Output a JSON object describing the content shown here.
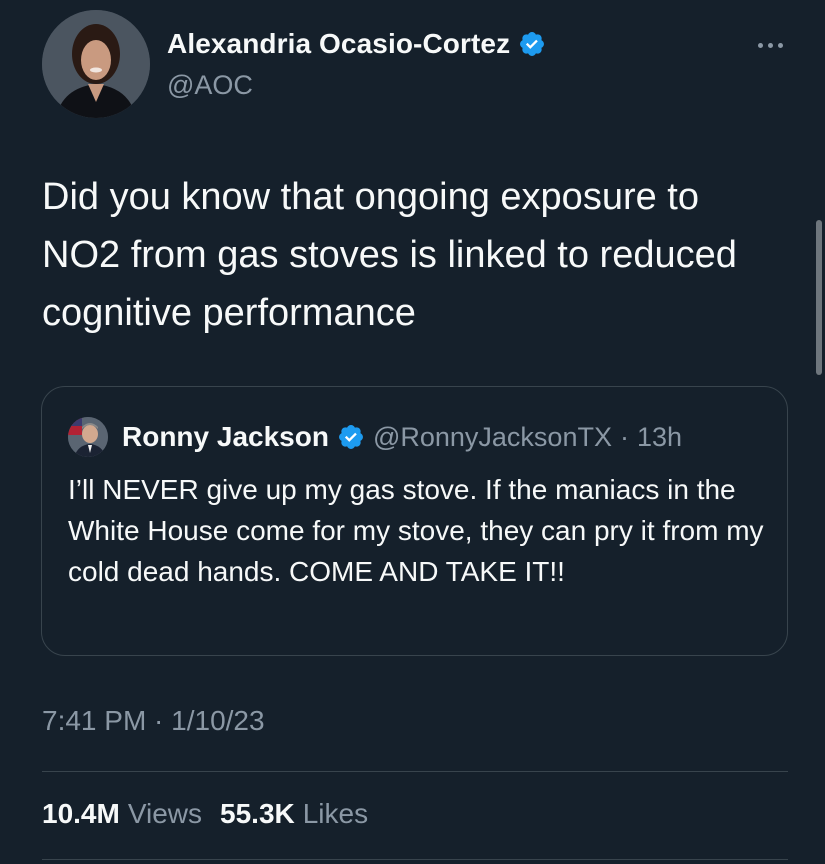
{
  "author": {
    "display_name": "Alexandria Ocasio-Cortez",
    "handle": "@AOC",
    "avatar_icon": "profile-photo",
    "verified_icon": "verified-badge-icon"
  },
  "tweet": {
    "text": "Did you know that ongoing exposure to NO2 from gas stoves is linked to reduced cognitive performance"
  },
  "quoted_tweet": {
    "display_name": "Ronny Jackson",
    "handle": "@RonnyJacksonTX",
    "separator": "·",
    "time": "13h",
    "text": "I’ll NEVER give up my gas stove. If the maniacs in the White House come for my stove, they can pry it from my cold dead hands. COME AND TAKE IT!!"
  },
  "meta": {
    "timestamp": "7:41 PM · 1/10/23"
  },
  "stats": {
    "views_count": "10.4M",
    "views_label": "Views",
    "likes_count": "55.3K",
    "likes_label": "Likes"
  },
  "colors": {
    "background": "#15202b",
    "text_primary": "#f7f9f9",
    "text_secondary": "#8b98a5",
    "border": "#38444d",
    "verified_blue": "#1d9bf0"
  }
}
